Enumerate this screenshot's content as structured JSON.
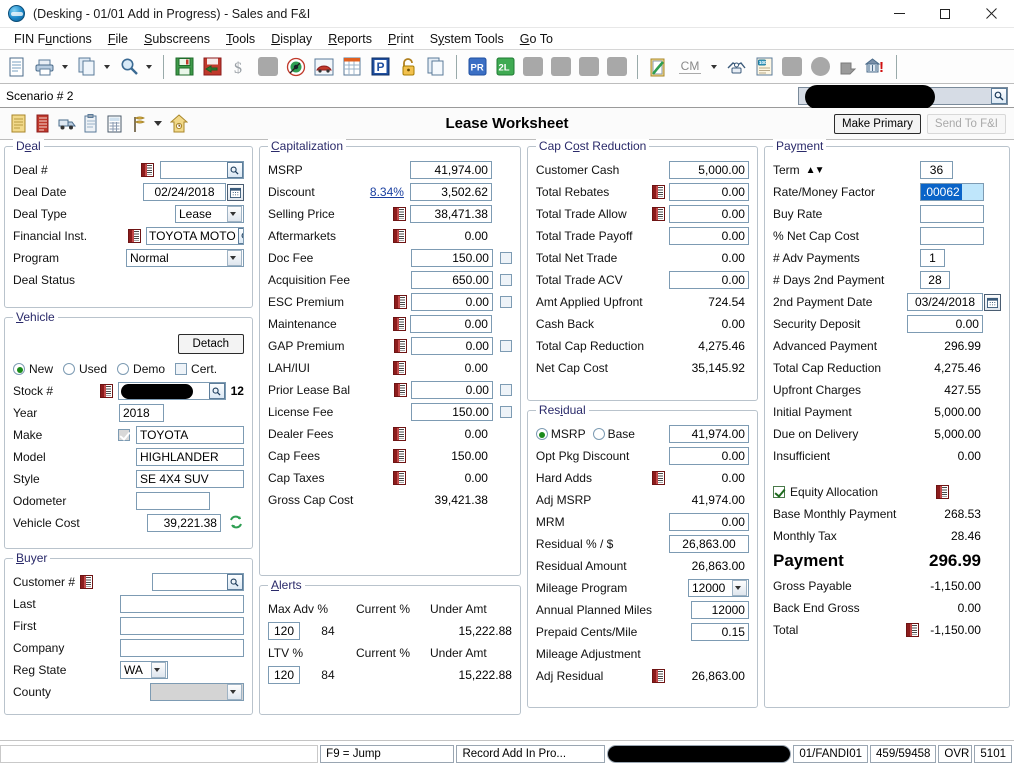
{
  "window": {
    "title": "(Desking - 01/01 Add in Progress) - Sales and F&I",
    "app_icon": "globe-icon",
    "minimize": "–",
    "maximize": "□",
    "close": "✕"
  },
  "menu": {
    "items": [
      {
        "label": "FIN Functions",
        "name": "menu-fin-functions"
      },
      {
        "label": "File",
        "name": "menu-file"
      },
      {
        "label": "Subscreens",
        "name": "menu-subscreens"
      },
      {
        "label": "Tools",
        "name": "menu-tools"
      },
      {
        "label": "Display",
        "name": "menu-display"
      },
      {
        "label": "Reports",
        "name": "menu-reports"
      },
      {
        "label": "Print",
        "name": "menu-print"
      },
      {
        "label": "System Tools",
        "name": "menu-system-tools"
      },
      {
        "label": "Go To",
        "name": "menu-go-to"
      }
    ]
  },
  "toolbar": {
    "cm_label": "CM",
    "icons": [
      "new-document-icon",
      "printer-icon",
      "copy-icon",
      "search-icon",
      "save-icon",
      "save-as-icon",
      "dollar-icon",
      "blank-grey-icon",
      "target-icon",
      "vehicle-icon",
      "grid-icon",
      "parking-p-icon",
      "unlock-icon",
      "pages-icon",
      "pr-icon",
      "2l-icon",
      "blank-grey-icon",
      "blank-grey-icon",
      "blank-grey-icon",
      "blank-grey-icon",
      "clipboard-check-icon",
      "handshake-icon",
      "money-doc-icon",
      "blank-grey-icon",
      "grey-circle-icon",
      "stamp-icon",
      "bank-alert-icon"
    ]
  },
  "scenario_bar": {
    "label": "Scenario # 2",
    "search_value": "",
    "search_icon": "search-icon",
    "redacted": true
  },
  "subbar": {
    "screen_title": "Lease Worksheet",
    "make_primary": "Make Primary",
    "send_to_fi": "Send To F&I",
    "send_to_fi_disabled": true,
    "icons": [
      "worksheet-icon",
      "ledger-icon",
      "truck-icon",
      "clipboard-icon",
      "calculator-icon",
      "flag-icon",
      "chevron-down-icon",
      "home-icon"
    ]
  },
  "deal": {
    "title": "Deal",
    "title_accel": "e",
    "rows": [
      {
        "label": "Deal #",
        "value": "",
        "type": "lookup",
        "ledger": true
      },
      {
        "label": "Deal Date",
        "value": "02/24/2018",
        "type": "date"
      },
      {
        "label": "Deal Type",
        "value": "Lease",
        "type": "dropdown"
      },
      {
        "label": "Financial Inst.",
        "value": "TOYOTA MOTO",
        "type": "lookup",
        "ledger": true
      },
      {
        "label": "Program",
        "value": "Normal",
        "type": "dropdown"
      },
      {
        "label": "Deal Status",
        "value": "",
        "type": "text-only"
      }
    ]
  },
  "vehicle": {
    "title": "Vehicle",
    "title_accel": "V",
    "detach_label": "Detach",
    "condition": {
      "options": [
        "New",
        "Used",
        "Demo"
      ],
      "selected": "New",
      "cert_label": "Cert.",
      "cert_checked": false
    },
    "stock": {
      "label": "Stock #",
      "value": "",
      "redacted": true,
      "suffix": "12"
    },
    "rows": [
      {
        "label": "Year",
        "value": "2018"
      },
      {
        "label": "Make",
        "value": "TOYOTA",
        "checked": true
      },
      {
        "label": "Model",
        "value": "HIGHLANDER"
      },
      {
        "label": "Style",
        "value": "SE 4X4 SUV"
      },
      {
        "label": "Odometer",
        "value": ""
      },
      {
        "label": "Vehicle Cost",
        "value": "39,221.38",
        "refresh": true
      }
    ]
  },
  "buyer": {
    "title": "Buyer",
    "title_accel": "B",
    "rows": [
      {
        "label": "Customer #",
        "value": "",
        "type": "lookup",
        "ledger": true
      },
      {
        "label": "Last",
        "value": "",
        "type": "text"
      },
      {
        "label": "First",
        "value": "",
        "type": "text"
      },
      {
        "label": "Company",
        "value": "",
        "type": "text"
      },
      {
        "label": "Reg State",
        "value": "WA",
        "type": "dropdown"
      },
      {
        "label": "County",
        "value": "",
        "type": "dropdown-grey"
      }
    ]
  },
  "capitalization": {
    "title": "Capitalization",
    "title_accel": "C",
    "rows": [
      {
        "label": "MSRP",
        "value": "41,974.00",
        "input": true
      },
      {
        "label": "Discount",
        "value": "3,502.62",
        "input": true,
        "link": "8.34%"
      },
      {
        "label": "Selling Price",
        "value": "38,471.38",
        "input": true,
        "ledger": true
      },
      {
        "label": "Aftermarkets",
        "value": "0.00",
        "input": false,
        "ledger": true
      },
      {
        "label": "Doc Fee",
        "value": "150.00",
        "input": true,
        "checkbox": true
      },
      {
        "label": "Acquisition Fee",
        "value": "650.00",
        "input": true,
        "checkbox": true
      },
      {
        "label": "ESC Premium",
        "value": "0.00",
        "input": true,
        "ledger": true,
        "checkbox": true
      },
      {
        "label": "Maintenance",
        "value": "0.00",
        "input": true,
        "ledger": true
      },
      {
        "label": "GAP Premium",
        "value": "0.00",
        "input": true,
        "ledger": true,
        "checkbox": true
      },
      {
        "label": "LAH/IUI",
        "value": "0.00",
        "input": false,
        "ledger": true
      },
      {
        "label": "Prior Lease Bal",
        "value": "0.00",
        "input": true,
        "ledger": true,
        "checkbox": true
      },
      {
        "label": "License Fee",
        "value": "150.00",
        "input": true,
        "checkbox": true
      },
      {
        "label": "Dealer Fees",
        "value": "0.00",
        "input": false,
        "ledger": true
      },
      {
        "label": "Cap Fees",
        "value": "150.00",
        "input": false,
        "ledger": true
      },
      {
        "label": "Cap Taxes",
        "value": "0.00",
        "input": false,
        "ledger": true
      },
      {
        "label": "Gross Cap Cost",
        "value": "39,421.38",
        "input": false
      }
    ]
  },
  "alerts": {
    "title": "Alerts",
    "title_accel": "A",
    "headers_1": [
      "Max Adv %",
      "Current %",
      "Under Amt"
    ],
    "row_1": [
      "120",
      "84",
      "15,222.88"
    ],
    "headers_2": [
      "LTV %",
      "Current %",
      "Under Amt"
    ],
    "row_2": [
      "120",
      "84",
      "15,222.88"
    ]
  },
  "cap_cost_reduction": {
    "title": "Cap Cost Reduction",
    "title_accel": "o",
    "rows": [
      {
        "label": "Customer Cash",
        "value": "5,000.00",
        "input": true
      },
      {
        "label": "Total Rebates",
        "value": "0.00",
        "input": true,
        "ledger": true
      },
      {
        "label": "Total Trade Allow",
        "value": "0.00",
        "input": true,
        "ledger": true
      },
      {
        "label": "Total Trade Payoff",
        "value": "0.00",
        "input": true
      },
      {
        "label": "Total Net Trade",
        "value": "0.00",
        "input": false
      },
      {
        "label": "Total Trade ACV",
        "value": "0.00",
        "input": true
      },
      {
        "label": "Amt Applied Upfront",
        "value": "724.54",
        "input": false
      },
      {
        "label": "Cash Back",
        "value": "0.00",
        "input": false
      },
      {
        "label": "Total Cap Reduction",
        "value": "4,275.46",
        "input": false
      },
      {
        "label": "Net Cap Cost",
        "value": "35,145.92",
        "input": false
      }
    ]
  },
  "residual": {
    "title": "Residual",
    "title_accel": "i",
    "basis": {
      "options": [
        "MSRP",
        "Base"
      ],
      "selected": "MSRP",
      "value": "41,974.00"
    },
    "rows": [
      {
        "label": "Opt Pkg Discount",
        "value": "0.00",
        "input": true
      },
      {
        "label": "Hard Adds",
        "value": "0.00",
        "input": false,
        "ledger": true
      },
      {
        "label": "Adj MSRP",
        "value": "41,974.00",
        "input": false
      },
      {
        "label": "MRM",
        "value": "0.00",
        "input": true
      },
      {
        "label": "Residual % / $",
        "value": "26,863.00",
        "input": true
      },
      {
        "label": "Residual Amount",
        "value": "26,863.00",
        "input": false
      },
      {
        "label": "Mileage Program",
        "value": "12000",
        "type": "dropdown"
      },
      {
        "label": "Annual Planned Miles",
        "value": "12000",
        "input": true
      },
      {
        "label": "Prepaid Cents/Mile",
        "value": "0.15",
        "input": true
      },
      {
        "label": "Mileage Adjustment",
        "value": "",
        "input": false
      },
      {
        "label": "Adj Residual",
        "value": "26,863.00",
        "input": false,
        "ledger": true
      }
    ]
  },
  "payment": {
    "title": "Payment",
    "title_accel": "m",
    "term": {
      "label": "Term",
      "value": "36",
      "spinner_up": "▲",
      "spinner_down": "▼"
    },
    "rows": [
      {
        "label": "Rate/Money Factor",
        "value": ".00062",
        "input": true,
        "focused": true
      },
      {
        "label": "Buy Rate",
        "value": "",
        "input": true
      },
      {
        "label": "% Net Cap Cost",
        "value": "",
        "input": true
      },
      {
        "label": "# Adv Payments",
        "value": "1",
        "input": true,
        "narrow": true
      },
      {
        "label": "# Days 2nd Payment",
        "value": "28",
        "input": true,
        "narrow": true
      },
      {
        "label": "2nd Payment Date",
        "value": "03/24/2018",
        "type": "date"
      },
      {
        "label": "Security Deposit",
        "value": "0.00",
        "input": true
      },
      {
        "label": "Advanced Payment",
        "value": "296.99",
        "input": false
      },
      {
        "label": "Total Cap Reduction",
        "value": "4,275.46",
        "input": false
      },
      {
        "label": "Upfront Charges",
        "value": "427.55",
        "input": false
      },
      {
        "label": "Initial Payment",
        "value": "5,000.00",
        "input": false
      },
      {
        "label": "Due on Delivery",
        "value": "5,000.00",
        "input": false
      },
      {
        "label": "Insufficient",
        "value": "0.00",
        "input": false
      }
    ]
  },
  "summary": {
    "equity_allocation": {
      "label": "Equity Allocation",
      "checked": true,
      "ledger": true
    },
    "rows": [
      {
        "label": "Base Monthly Payment",
        "value": "268.53"
      },
      {
        "label": "Monthly Tax",
        "value": "28.46"
      }
    ],
    "payment_total": {
      "label": "Payment",
      "value": "296.99"
    },
    "rows2": [
      {
        "label": "Gross Payable",
        "value": "-1,150.00"
      },
      {
        "label": "Back End Gross",
        "value": "0.00"
      },
      {
        "label": "Total",
        "value": "-1,150.00",
        "ledger": true
      }
    ]
  },
  "status_bar": {
    "segments": [
      {
        "text": "F9 = Jump",
        "name": "status-f9-jump"
      },
      {
        "text": "Record Add In Pro...",
        "name": "status-record"
      },
      {
        "text": "",
        "name": "status-redacted",
        "redacted": true
      },
      {
        "text": "01/FANDI01",
        "name": "status-terminal"
      },
      {
        "text": "459/59458",
        "name": "status-session"
      },
      {
        "text": "OVR",
        "name": "status-ovr"
      },
      {
        "text": "5101",
        "name": "status-code"
      }
    ]
  },
  "colors": {
    "group_title": "#2a2a6a",
    "link": "#1a3fa0",
    "focus_field": "#bfe6fb",
    "selection": "#0a64c8",
    "ledger_red": "#8c1c1c"
  }
}
